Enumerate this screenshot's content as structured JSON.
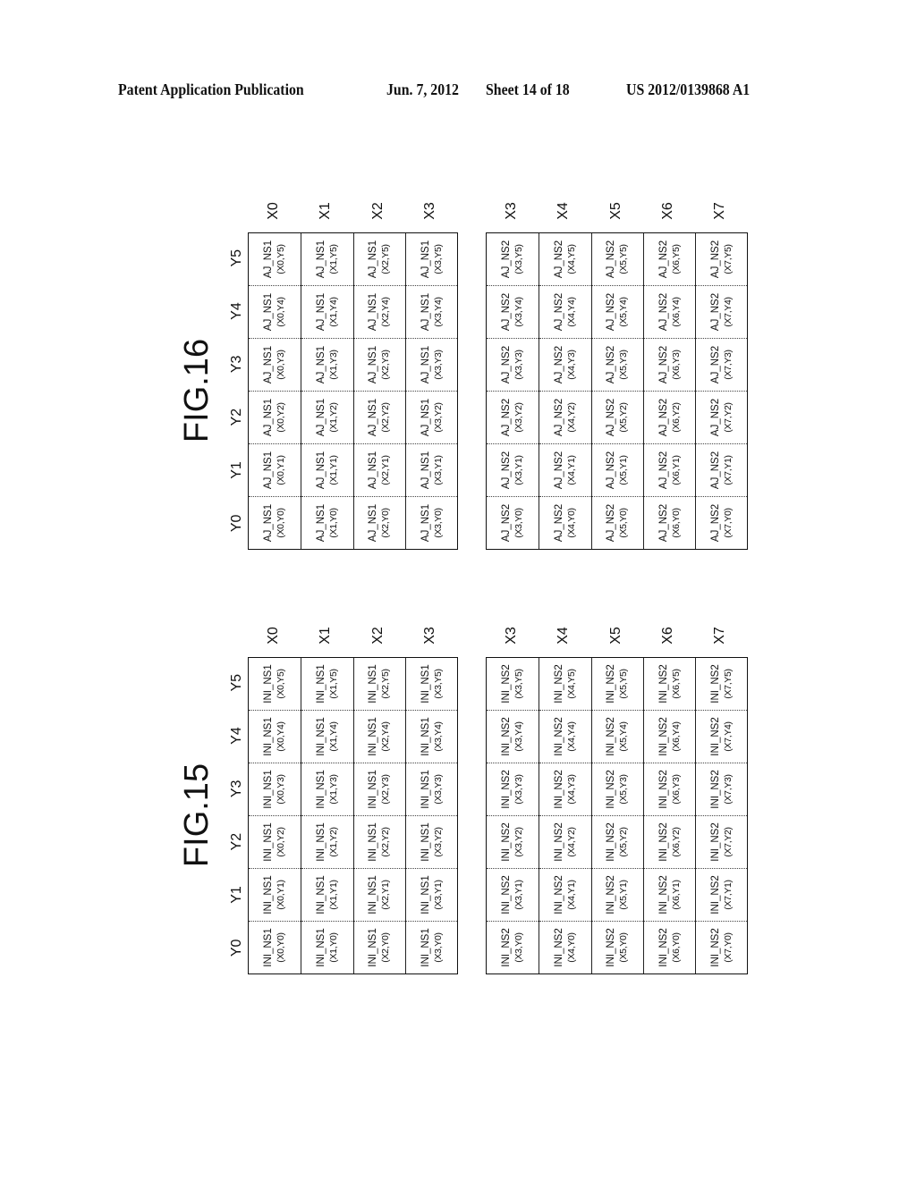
{
  "header": {
    "publication": "Patent Application Publication",
    "date": "Jun. 7, 2012",
    "sheet": "Sheet 14 of 18",
    "number": "US 2012/0139868 A1"
  },
  "figures": [
    {
      "title": "FIG.15",
      "columns": [
        "Y0",
        "Y1",
        "Y2",
        "Y3",
        "Y4",
        "Y5"
      ],
      "tables": [
        {
          "prefix": "INI_NS1",
          "rows": [
            "X0",
            "X1",
            "X2",
            "X3"
          ]
        },
        {
          "prefix": "INI_NS2",
          "rows": [
            "X3",
            "X4",
            "X5",
            "X6",
            "X7"
          ]
        }
      ]
    },
    {
      "title": "FIG.16",
      "columns": [
        "Y0",
        "Y1",
        "Y2",
        "Y3",
        "Y4",
        "Y5"
      ],
      "tables": [
        {
          "prefix": "AJ_NS1",
          "rows": [
            "X0",
            "X1",
            "X2",
            "X3"
          ]
        },
        {
          "prefix": "AJ_NS2",
          "rows": [
            "X3",
            "X4",
            "X5",
            "X6",
            "X7"
          ]
        }
      ]
    }
  ]
}
